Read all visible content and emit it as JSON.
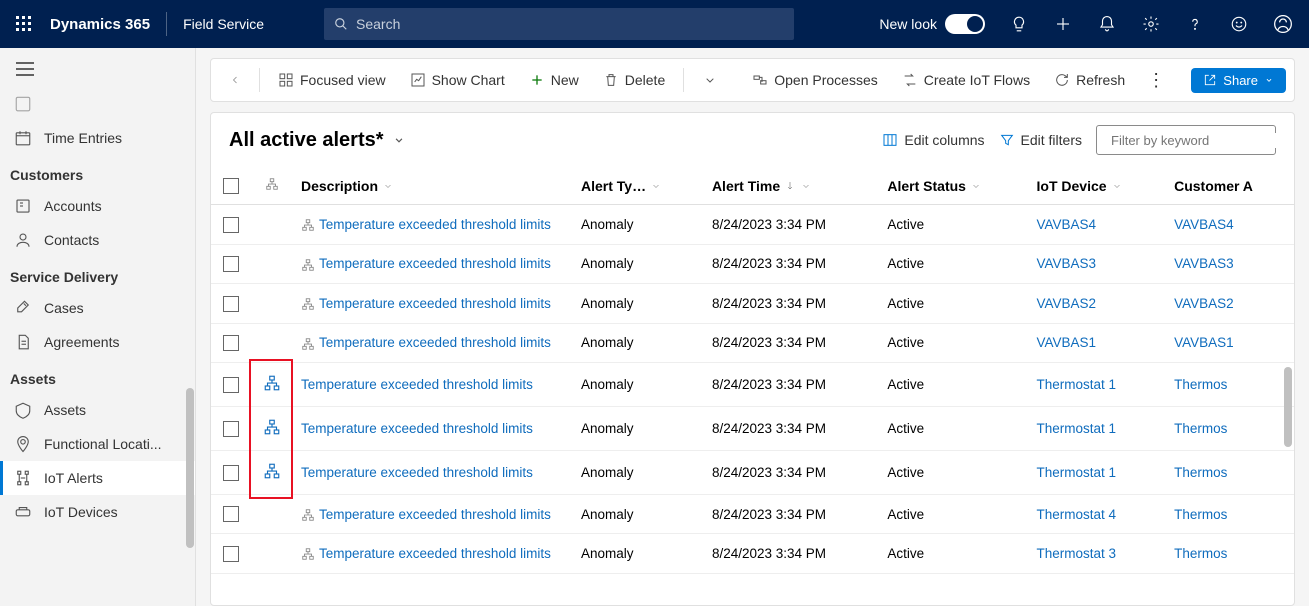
{
  "topbar": {
    "brand": "Dynamics 365",
    "app": "Field Service",
    "search_placeholder": "Search",
    "new_look": "New look"
  },
  "sidebar": {
    "item_truncated": "…",
    "time_entries": "Time Entries",
    "hdr_customers": "Customers",
    "accounts": "Accounts",
    "contacts": "Contacts",
    "hdr_service": "Service Delivery",
    "cases": "Cases",
    "agreements": "Agreements",
    "hdr_assets": "Assets",
    "assets": "Assets",
    "functional": "Functional Locati...",
    "iot_alerts": "IoT Alerts",
    "iot_devices": "IoT Devices"
  },
  "cmdbar": {
    "focused": "Focused view",
    "show_chart": "Show Chart",
    "new": "New",
    "delete": "Delete",
    "open_processes": "Open Processes",
    "create_iot_flows": "Create IoT Flows",
    "refresh": "Refresh",
    "share": "Share"
  },
  "view": {
    "name": "All active alerts*",
    "edit_columns": "Edit columns",
    "edit_filters": "Edit filters",
    "filter_placeholder": "Filter by keyword"
  },
  "columns": {
    "description": "Description",
    "alert_type": "Alert Ty…",
    "alert_time": "Alert Time",
    "alert_status": "Alert Status",
    "iot_device": "IoT Device",
    "customer": "Customer A"
  },
  "rows": [
    {
      "desc": "Temperature exceeded threshold limits",
      "type": "Anomaly",
      "time": "8/24/2023 3:34 PM",
      "status": "Active",
      "device": "VAVBAS4",
      "customer": "VAVBAS4",
      "hier": false,
      "inline": true
    },
    {
      "desc": "Temperature exceeded threshold limits",
      "type": "Anomaly",
      "time": "8/24/2023 3:34 PM",
      "status": "Active",
      "device": "VAVBAS3",
      "customer": "VAVBAS3",
      "hier": false,
      "inline": true
    },
    {
      "desc": "Temperature exceeded threshold limits",
      "type": "Anomaly",
      "time": "8/24/2023 3:34 PM",
      "status": "Active",
      "device": "VAVBAS2",
      "customer": "VAVBAS2",
      "hier": false,
      "inline": true
    },
    {
      "desc": "Temperature exceeded threshold limits",
      "type": "Anomaly",
      "time": "8/24/2023 3:34 PM",
      "status": "Active",
      "device": "VAVBAS1",
      "customer": "VAVBAS1",
      "hier": false,
      "inline": true
    },
    {
      "desc": "Temperature exceeded threshold limits",
      "type": "Anomaly",
      "time": "8/24/2023 3:34 PM",
      "status": "Active",
      "device": "Thermostat 1",
      "customer": "Thermos",
      "hier": true,
      "inline": false
    },
    {
      "desc": "Temperature exceeded threshold limits",
      "type": "Anomaly",
      "time": "8/24/2023 3:34 PM",
      "status": "Active",
      "device": "Thermostat 1",
      "customer": "Thermos",
      "hier": true,
      "inline": false
    },
    {
      "desc": "Temperature exceeded threshold limits",
      "type": "Anomaly",
      "time": "8/24/2023 3:34 PM",
      "status": "Active",
      "device": "Thermostat 1",
      "customer": "Thermos",
      "hier": true,
      "inline": false
    },
    {
      "desc": "Temperature exceeded threshold limits",
      "type": "Anomaly",
      "time": "8/24/2023 3:34 PM",
      "status": "Active",
      "device": "Thermostat 4",
      "customer": "Thermos",
      "hier": false,
      "inline": true
    },
    {
      "desc": "Temperature exceeded threshold limits",
      "type": "Anomaly",
      "time": "8/24/2023 3:34 PM",
      "status": "Active",
      "device": "Thermostat 3",
      "customer": "Thermos",
      "hier": false,
      "inline": true
    }
  ]
}
